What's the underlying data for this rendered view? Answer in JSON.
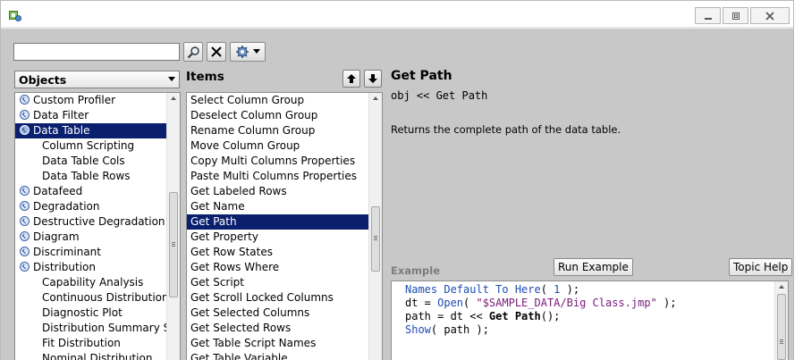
{
  "toolbar": {
    "search_value": "",
    "search_placeholder": ""
  },
  "objects": {
    "selected": "Objects",
    "items": [
      {
        "label": "Custom Profiler",
        "child": false
      },
      {
        "label": "Data Filter",
        "child": false
      },
      {
        "label": "Data Table",
        "child": false,
        "selected": true
      },
      {
        "label": "Column Scripting",
        "child": true
      },
      {
        "label": "Data Table Cols",
        "child": true
      },
      {
        "label": "Data Table Rows",
        "child": true
      },
      {
        "label": "Datafeed",
        "child": false
      },
      {
        "label": "Degradation",
        "child": false
      },
      {
        "label": "Destructive Degradation",
        "child": false
      },
      {
        "label": "Diagram",
        "child": false
      },
      {
        "label": "Discriminant",
        "child": false
      },
      {
        "label": "Distribution",
        "child": false
      },
      {
        "label": "Capability Analysis",
        "child": true
      },
      {
        "label": "Continuous Distribution",
        "child": true
      },
      {
        "label": "Diagnostic Plot",
        "child": true
      },
      {
        "label": "Distribution Summary Stat",
        "child": true
      },
      {
        "label": "Fit Distribution",
        "child": true
      },
      {
        "label": "Nominal Distribution",
        "child": true
      }
    ]
  },
  "items_panel": {
    "header": "Items",
    "items": [
      "Select Column Group",
      "Deselect Column Group",
      "Rename Column Group",
      "Move Column Group",
      "Copy Multi Columns Properties",
      "Paste Multi Columns Properties",
      "Get Labeled Rows",
      "Get Name",
      "Get Path",
      "Get Property",
      "Get Row States",
      "Get Rows Where",
      "Get Script",
      "Get Scroll Locked Columns",
      "Get Selected Columns",
      "Get Selected Rows",
      "Get Table Script Names",
      "Get Table Variable"
    ],
    "selected_index": 8
  },
  "detail": {
    "title": "Get Path",
    "syntax": "obj << Get Path",
    "description": "Returns the complete path of the data table.",
    "example_label": "Example",
    "run_example_label": "Run Example",
    "topic_help_label": "Topic Help"
  },
  "code": {
    "l1_fn": "Names Default To Here",
    "l1_open": "( ",
    "l1_num": "1",
    "l1_close": " );",
    "l2_a": "dt = ",
    "l2_fn": "Open",
    "l2_b": "( ",
    "l2_str": "\"$SAMPLE_DATA/Big Class.jmp\"",
    "l2_c": " );",
    "l3_a": "path = dt << ",
    "l3_msg": "Get Path",
    "l3_b": "();",
    "l4_fn": "Show",
    "l4_b": "( path );"
  }
}
